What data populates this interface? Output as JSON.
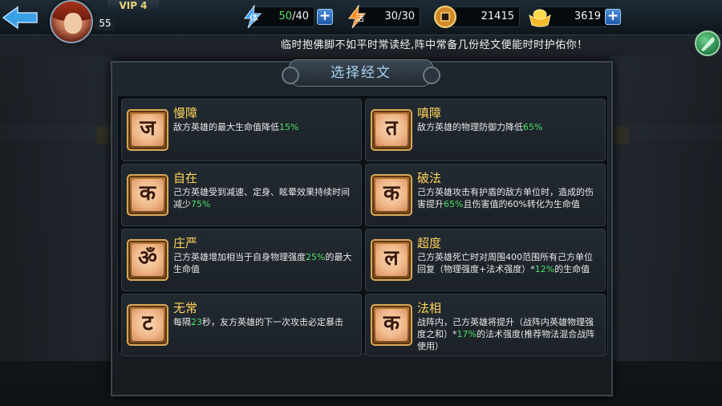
{
  "topbar": {
    "vip": "VIP 4",
    "level": "55",
    "stamina": {
      "label": "体",
      "current": "50",
      "max": "/40"
    },
    "vigor": {
      "label": "活",
      "value": "30/30"
    },
    "coins": "21415",
    "gold": "3619"
  },
  "tip": "临时抱佛脚不如平时常读经,阵中常备几份经文便能时时护佑你！",
  "dialog": {
    "title": "选择经文"
  },
  "scriptures": [
    {
      "name": "慢障",
      "glyph": "ज",
      "desc_pre": "敌方英雄的最大生命值降低",
      "highlight": "15%",
      "desc_post": ""
    },
    {
      "name": "嗔障",
      "glyph": "त",
      "desc_pre": "敌方英雄的物理防御力降低",
      "highlight": "65%",
      "desc_post": ""
    },
    {
      "name": "自在",
      "glyph": "क",
      "desc_pre": "己方英雄受到减速、定身、眩晕效果持续时间减少",
      "highlight": "75%",
      "desc_post": ""
    },
    {
      "name": "破法",
      "glyph": "क",
      "desc_pre": "己方英雄攻击有护盾的敌方单位时，造成的伤害提升",
      "highlight": "65%",
      "desc_post": "且伤害值的60%转化为生命值"
    },
    {
      "name": "庄严",
      "glyph": "ॐ",
      "desc_pre": "己方英雄增加相当于自身物理强度",
      "highlight": "25%",
      "desc_post": "的最大生命值"
    },
    {
      "name": "超度",
      "glyph": "ल",
      "desc_pre": "己方英雄死亡时对周围400范围所有己方单位回复（物理强度+法术强度）*",
      "highlight": "12%",
      "desc_post": "的生命值"
    },
    {
      "name": "无常",
      "glyph": "ट",
      "desc_pre": "每隔",
      "highlight": "23",
      "desc_post": "秒，友方英雄的下一次攻击必定暴击"
    },
    {
      "name": "法相",
      "glyph": "क",
      "desc_pre": "战阵内，己方英雄将提升（战阵内英雄物理强度之和）*",
      "highlight": "17%",
      "desc_post": "的法术强度(推荐物法混合战阵使用）"
    }
  ],
  "colors": {
    "accent_gold": "#ffd35a",
    "highlight_green": "#4fe06a",
    "title_blue": "#a9d3f2"
  }
}
